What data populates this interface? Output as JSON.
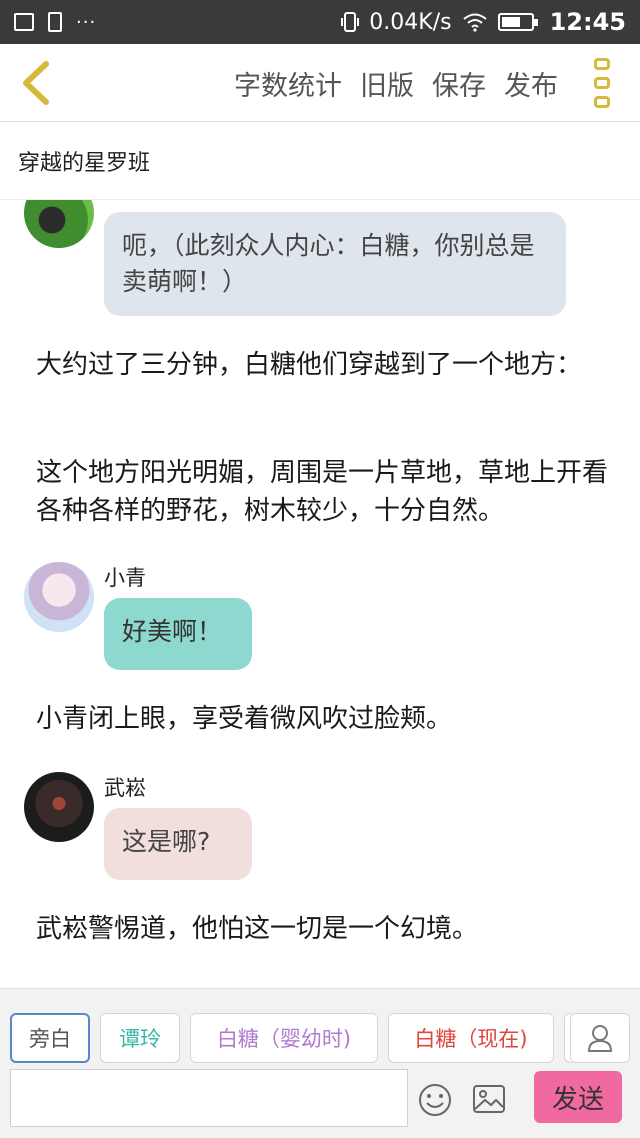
{
  "status": {
    "speed": "0.04K/s",
    "time": "12:45"
  },
  "toolbar": {
    "word_count": "字数统计",
    "old_version": "旧版",
    "save": "保存",
    "publish": "发布"
  },
  "story_title": "穿越的星罗班",
  "messages": [
    {
      "type": "bubble",
      "text": "呃，（此刻众人内心：白糖，你别总是卖萌啊！）",
      "color": "#dfe5ec"
    },
    {
      "type": "narration",
      "text": "大约过了三分钟，白糖他们穿越到了一个地方："
    },
    {
      "type": "narration",
      "text": "这个地方阳光明媚，周围是一片草地，草地上开看各种各样的野花，树木较少，十分自然。"
    },
    {
      "type": "bubble",
      "speaker": "小青",
      "text": "好美啊！",
      "color": "#8dd9cf"
    },
    {
      "type": "narration",
      "text": "小青闭上眼，享受着微风吹过脸颊。"
    },
    {
      "type": "bubble",
      "speaker": "武崧",
      "text": "这是哪?",
      "color": "#f1dedd"
    },
    {
      "type": "narration",
      "text": "武崧警惕道，他怕这一切是一个幻境。"
    }
  ],
  "roles": [
    {
      "label": "旁白",
      "color": "#555555",
      "selected": true
    },
    {
      "label": "谭玲",
      "color": "#39b8a6"
    },
    {
      "label": "白糖（婴幼时)",
      "color": "#b07ad0"
    },
    {
      "label": "白糖（现在)",
      "color": "#e0453c"
    }
  ],
  "input": {
    "placeholder": ""
  },
  "send_label": "发送"
}
